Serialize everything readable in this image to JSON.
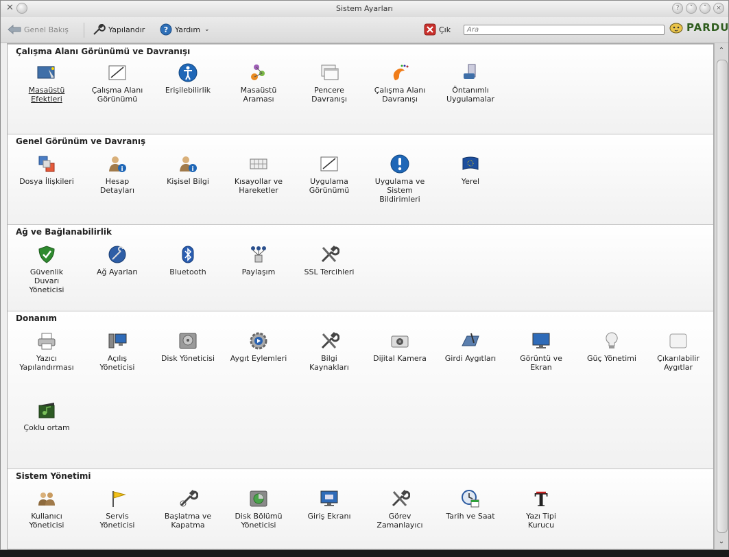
{
  "window": {
    "title": "Sistem Ayarları"
  },
  "toolbar": {
    "overview": "Genel Bakış",
    "configure": "Yapılandır",
    "help": "Yardım",
    "quit": "Çık",
    "search_placeholder": "Ara",
    "logo": "PARDUS"
  },
  "sections": [
    {
      "title": "Çalışma Alanı Görünümü ve Davranışı",
      "items": [
        {
          "label": "Masaüstü\nEfektleri",
          "icon": "desktop-effects-icon"
        },
        {
          "label": "Çalışma Alanı\nGörünümü",
          "icon": "workspace-appearance-icon"
        },
        {
          "label": "Erişilebilirlik",
          "icon": "accessibility-icon"
        },
        {
          "label": "Masaüstü\nAraması",
          "icon": "desktop-search-icon"
        },
        {
          "label": "Pencere\nDavranışı",
          "icon": "window-behavior-icon"
        },
        {
          "label": "Çalışma Alanı\nDavranışı",
          "icon": "workspace-behavior-icon"
        },
        {
          "label": "Öntanımlı\nUygulamalar",
          "icon": "default-applications-icon"
        }
      ]
    },
    {
      "title": "Genel Görünüm ve Davranış",
      "items": [
        {
          "label": "Dosya İlişkileri",
          "icon": "file-associations-icon"
        },
        {
          "label": "Hesap\nDetayları",
          "icon": "account-details-icon"
        },
        {
          "label": "Kişisel Bilgi",
          "icon": "personal-info-icon"
        },
        {
          "label": "Kısayollar ve\nHareketler",
          "icon": "shortcuts-icon"
        },
        {
          "label": "Uygulama\nGörünümü",
          "icon": "application-appearance-icon"
        },
        {
          "label": "Uygulama ve\nSistem\nBildirimleri",
          "icon": "notifications-icon"
        },
        {
          "label": "Yerel",
          "icon": "locale-icon"
        }
      ]
    },
    {
      "title": "Ağ ve Bağlanabilirlik",
      "items": [
        {
          "label": "Güvenlik\nDuvarı\nYöneticisi",
          "icon": "firewall-icon"
        },
        {
          "label": "Ağ Ayarları",
          "icon": "network-settings-icon"
        },
        {
          "label": "Bluetooth",
          "icon": "bluetooth-icon"
        },
        {
          "label": "Paylaşım",
          "icon": "sharing-icon"
        },
        {
          "label": "SSL Tercihleri",
          "icon": "ssl-preferences-icon"
        }
      ]
    },
    {
      "title": "Donanım",
      "items": [
        {
          "label": "Yazıcı\nYapılandırması",
          "icon": "printer-icon"
        },
        {
          "label": "Açılış\nYöneticisi",
          "icon": "boot-manager-icon"
        },
        {
          "label": "Disk Yöneticisi",
          "icon": "disk-manager-icon"
        },
        {
          "label": "Aygıt Eylemleri",
          "icon": "device-actions-icon"
        },
        {
          "label": "Bilgi\nKaynakları",
          "icon": "info-sources-icon"
        },
        {
          "label": "Dijital Kamera",
          "icon": "digital-camera-icon"
        },
        {
          "label": "Girdi Aygıtları",
          "icon": "input-devices-icon"
        },
        {
          "label": "Görüntü ve\nEkran",
          "icon": "display-icon"
        },
        {
          "label": "Güç Yönetimi",
          "icon": "power-management-icon"
        },
        {
          "label": "Çıkarılabilir\nAygıtlar",
          "icon": "removable-devices-icon"
        },
        {
          "label": "Çoklu ortam",
          "icon": "multimedia-icon"
        }
      ]
    },
    {
      "title": "Sistem Yönetimi",
      "items": [
        {
          "label": "Kullanıcı\nYöneticisi",
          "icon": "user-manager-icon"
        },
        {
          "label": "Servis\nYöneticisi",
          "icon": "service-manager-icon"
        },
        {
          "label": "Başlatma ve\nKapatma",
          "icon": "startup-shutdown-icon"
        },
        {
          "label": "Disk Bölümü\nYöneticisi",
          "icon": "partition-manager-icon"
        },
        {
          "label": "Giriş Ekranı",
          "icon": "login-screen-icon"
        },
        {
          "label": "Görev\nZamanlayıcı",
          "icon": "task-scheduler-icon"
        },
        {
          "label": "Tarih ve Saat",
          "icon": "date-time-icon"
        },
        {
          "label": "Yazı Tipi\nKurucu",
          "icon": "font-installer-icon"
        }
      ]
    }
  ]
}
